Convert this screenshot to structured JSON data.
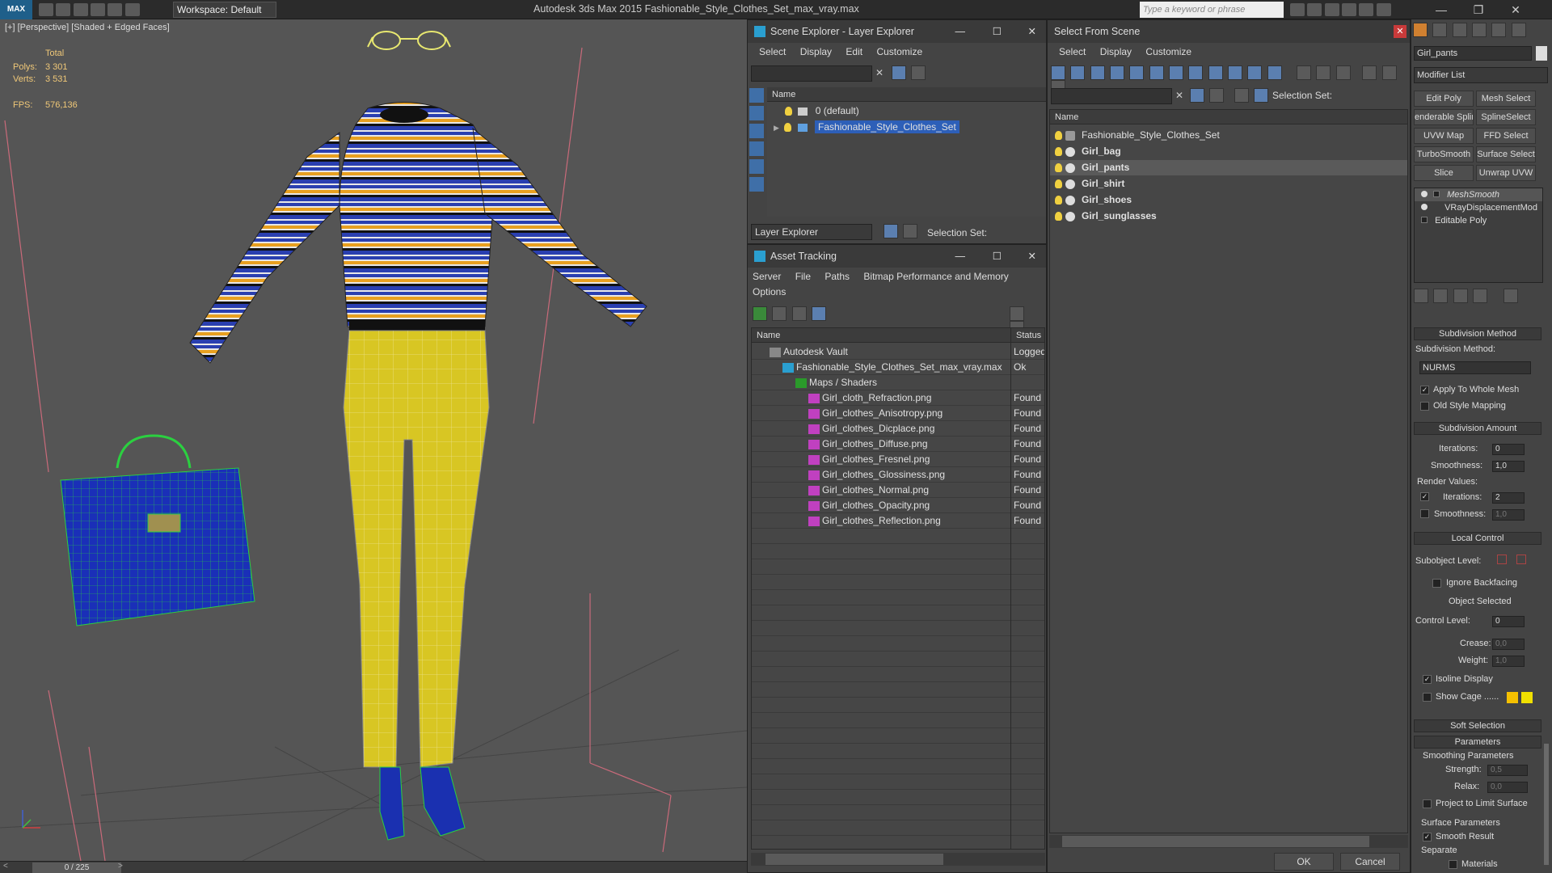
{
  "titlebar": {
    "logo": "MAX",
    "workspace": "Workspace: Default",
    "app_title": "Autodesk 3ds Max  2015      Fashionable_Style_Clothes_Set_max_vray.max",
    "search_placeholder": "Type a keyword or phrase"
  },
  "viewport": {
    "label": "[+] [Perspective] [Shaded + Edged Faces]",
    "stats": {
      "total_label": "Total",
      "polys_label": "Polys:",
      "polys_value": "3 301",
      "verts_label": "Verts:",
      "verts_value": "3 531",
      "fps_label": "FPS:",
      "fps_value": "576,136"
    },
    "time_slider": "0 / 225"
  },
  "scene_explorer": {
    "title": "Scene Explorer - Layer Explorer",
    "menu": [
      "Select",
      "Display",
      "Edit",
      "Customize"
    ],
    "col_name": "Name",
    "rows": [
      {
        "label": "0 (default)",
        "selected": false
      },
      {
        "label": "Fashionable_Style_Clothes_Set",
        "selected": true
      }
    ],
    "footer_dropdown": "Layer Explorer",
    "footer_selection": "Selection Set:"
  },
  "asset_tracking": {
    "title": "Asset Tracking",
    "menu": [
      "Server",
      "File",
      "Paths",
      "Bitmap Performance and Memory"
    ],
    "menu2": "Options",
    "col_name": "Name",
    "col_status": "Status",
    "rows": [
      {
        "name": "Autodesk Vault",
        "status": "Logged",
        "indent": 0
      },
      {
        "name": "Fashionable_Style_Clothes_Set_max_vray.max",
        "status": "Ok",
        "indent": 1
      },
      {
        "name": "Maps / Shaders",
        "status": "",
        "indent": 2
      },
      {
        "name": "Girl_cloth_Refraction.png",
        "status": "Found",
        "indent": 3
      },
      {
        "name": "Girl_clothes_Anisotropy.png",
        "status": "Found",
        "indent": 3
      },
      {
        "name": "Girl_clothes_Dicplace.png",
        "status": "Found",
        "indent": 3
      },
      {
        "name": "Girl_clothes_Diffuse.png",
        "status": "Found",
        "indent": 3
      },
      {
        "name": "Girl_clothes_Fresnel.png",
        "status": "Found",
        "indent": 3
      },
      {
        "name": "Girl_clothes_Glossiness.png",
        "status": "Found",
        "indent": 3
      },
      {
        "name": "Girl_clothes_Normal.png",
        "status": "Found",
        "indent": 3
      },
      {
        "name": "Girl_clothes_Opacity.png",
        "status": "Found",
        "indent": 3
      },
      {
        "name": "Girl_clothes_Reflection.png",
        "status": "Found",
        "indent": 3
      }
    ]
  },
  "select_from_scene": {
    "title": "Select From Scene",
    "menu": [
      "Select",
      "Display",
      "Customize"
    ],
    "selection_set": "Selection Set:",
    "col_name": "Name",
    "rows": [
      {
        "label": "Fashionable_Style_Clothes_Set",
        "bold": false,
        "selected": false
      },
      {
        "label": "Girl_bag",
        "bold": true,
        "selected": false
      },
      {
        "label": "Girl_pants",
        "bold": true,
        "selected": true
      },
      {
        "label": "Girl_shirt",
        "bold": true,
        "selected": false
      },
      {
        "label": "Girl_shoes",
        "bold": true,
        "selected": false
      },
      {
        "label": "Girl_sunglasses",
        "bold": true,
        "selected": false
      }
    ],
    "ok": "OK",
    "cancel": "Cancel"
  },
  "command_panel": {
    "object_name": "Girl_pants",
    "modifier_list": "Modifier List",
    "buttons": [
      "Edit Poly",
      "Mesh Select",
      "enderable Splin",
      "SplineSelect",
      "UVW Map",
      "FFD Select",
      "TurboSmooth",
      "Surface Select",
      "Slice",
      "Unwrap UVW"
    ],
    "stack": [
      "MeshSmooth",
      "VRayDisplacementMod",
      "Editable Poly"
    ],
    "subdivision_method_header": "Subdivision Method",
    "subdivision_method_label": "Subdivision Method:",
    "subdivision_method_value": "NURMS",
    "apply_whole_mesh": "Apply To Whole Mesh",
    "old_style_mapping": "Old Style Mapping",
    "subdivision_amount_header": "Subdivision Amount",
    "iterations_label": "Iterations:",
    "iterations_value": "0",
    "smoothness_label": "Smoothness:",
    "smoothness_value": "1,0",
    "render_values": "Render Values:",
    "render_iterations_label": "Iterations:",
    "render_iterations_value": "2",
    "render_smoothness_label": "Smoothness:",
    "render_smoothness_value": "1,0",
    "local_control_header": "Local Control",
    "subobject_level": "Subobject Level:",
    "ignore_backfacing": "Ignore Backfacing",
    "object_selected": "Object Selected",
    "control_level_label": "Control Level:",
    "control_level_value": "0",
    "crease_label": "Crease:",
    "crease_value": "0,0",
    "weight_label": "Weight:",
    "weight_value": "1,0",
    "isoline_display": "Isoline Display",
    "show_cage": "Show Cage ......",
    "soft_selection_header": "Soft Selection",
    "parameters_header": "Parameters",
    "smoothing_parameters": "Smoothing Parameters",
    "strength_label": "Strength:",
    "strength_value": "0,5",
    "relax_label": "Relax:",
    "relax_value": "0,0",
    "project_limit": "Project to Limit Surface",
    "surface_parameters": "Surface Parameters",
    "smooth_result": "Smooth Result",
    "separate": "Separate",
    "materials": "Materials",
    "cage_color_1": "#f5c000",
    "cage_color_2": "#f0e000"
  },
  "colors": {
    "selection_blue": "#2d5fb8",
    "pants_yellow": "#d8c623",
    "stat_yellow": "#f0c878"
  }
}
